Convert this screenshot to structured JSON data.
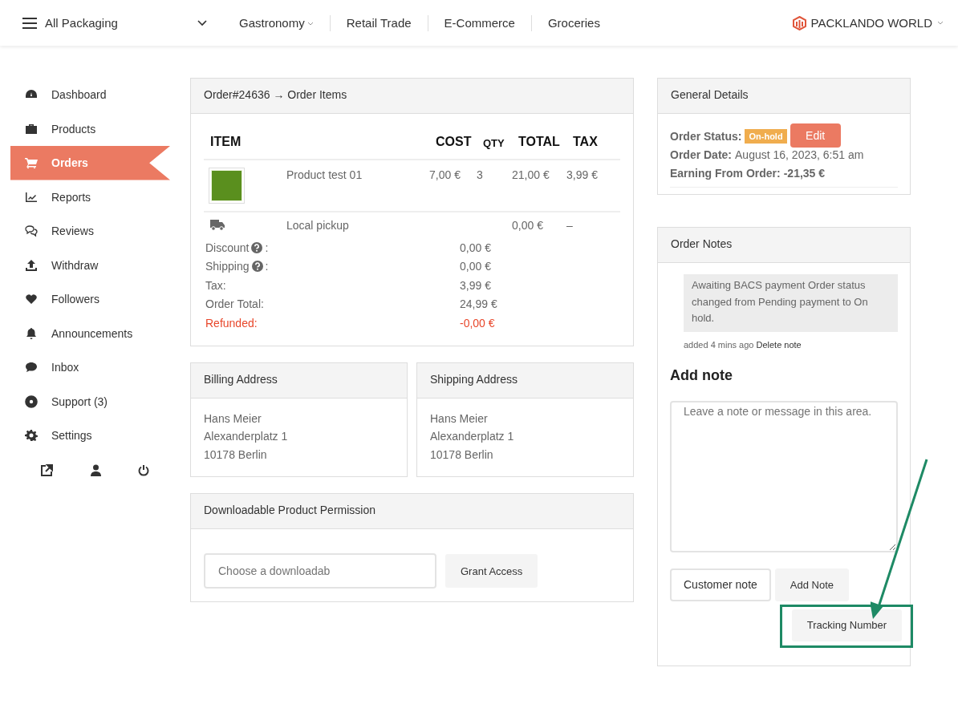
{
  "header": {
    "category": "All Packaging",
    "nav": [
      {
        "label": "Gastronomy",
        "dropdown": true
      },
      {
        "label": "Retail Trade",
        "dropdown": false
      },
      {
        "label": "E-Commerce",
        "dropdown": false
      },
      {
        "label": "Groceries",
        "dropdown": false
      }
    ],
    "brand": "PACKLANDO WORLD"
  },
  "sidebar": {
    "items": [
      {
        "label": "Dashboard",
        "selected": false
      },
      {
        "label": "Products",
        "selected": false
      },
      {
        "label": "Orders",
        "selected": true
      },
      {
        "label": "Reports",
        "selected": false
      },
      {
        "label": "Reviews",
        "selected": false
      },
      {
        "label": "Withdraw",
        "selected": false
      },
      {
        "label": "Followers",
        "selected": false
      },
      {
        "label": "Announcements",
        "selected": false
      },
      {
        "label": "Inbox",
        "selected": false
      },
      {
        "label": "Support (3)",
        "selected": false
      },
      {
        "label": "Settings",
        "selected": false
      }
    ]
  },
  "order_items": {
    "title": "Order#24636 → Order Items",
    "columns": [
      "ITEM",
      "COST",
      "QTY",
      "TOTAL",
      "TAX"
    ],
    "rows": [
      {
        "kind": "product",
        "name": "Product test 01",
        "cost": "7,00 €",
        "qty": "3",
        "total": "21,00 €",
        "tax": "3,99 €"
      },
      {
        "kind": "shipping",
        "name": "Local pickup",
        "total": "0,00 €",
        "tax": "–"
      }
    ],
    "totals": [
      {
        "label": "Discount",
        "help": true,
        "colon": ":",
        "value": "0,00 €",
        "kind": "normal"
      },
      {
        "label": "Shipping",
        "help": true,
        "colon": ":",
        "value": "0,00 €",
        "kind": "normal"
      },
      {
        "label": "Tax:",
        "help": false,
        "value": "3,99 €",
        "kind": "normal"
      },
      {
        "label": "Order Total:",
        "help": false,
        "value": "24,99 €",
        "kind": "normal"
      },
      {
        "label": "Refunded:",
        "help": false,
        "value": "-0,00 €",
        "kind": "refund"
      }
    ]
  },
  "billing": {
    "title": "Billing Address",
    "lines": [
      "Hans Meier",
      "Alexanderplatz 1",
      "10178 Berlin"
    ]
  },
  "shipping": {
    "title": "Shipping Address",
    "lines": [
      "Hans Meier",
      "Alexanderplatz 1",
      "10178 Berlin"
    ]
  },
  "downloads": {
    "title": "Downloadable Product Permission",
    "placeholder": "Choose a downloadab",
    "button": "Grant Access"
  },
  "general": {
    "title": "General Details",
    "status_label": "Order Status:",
    "status": "On-hold",
    "edit": "Edit",
    "date_label": "Order Date:",
    "date": "August 16, 2023, 6:51 am",
    "earning_label": "Earning From Order:",
    "earning": "-21,35 €"
  },
  "notes": {
    "title": "Order Notes",
    "note": "Awaiting BACS payment Order status changed from Pending payment to On hold.",
    "meta": "added 4 mins ago",
    "delete": "Delete note",
    "add_title": "Add note",
    "placeholder": "Leave a note or message in this area.",
    "note_type": "Customer note",
    "add_button": "Add Note",
    "tracking_button": "Tracking Number"
  }
}
